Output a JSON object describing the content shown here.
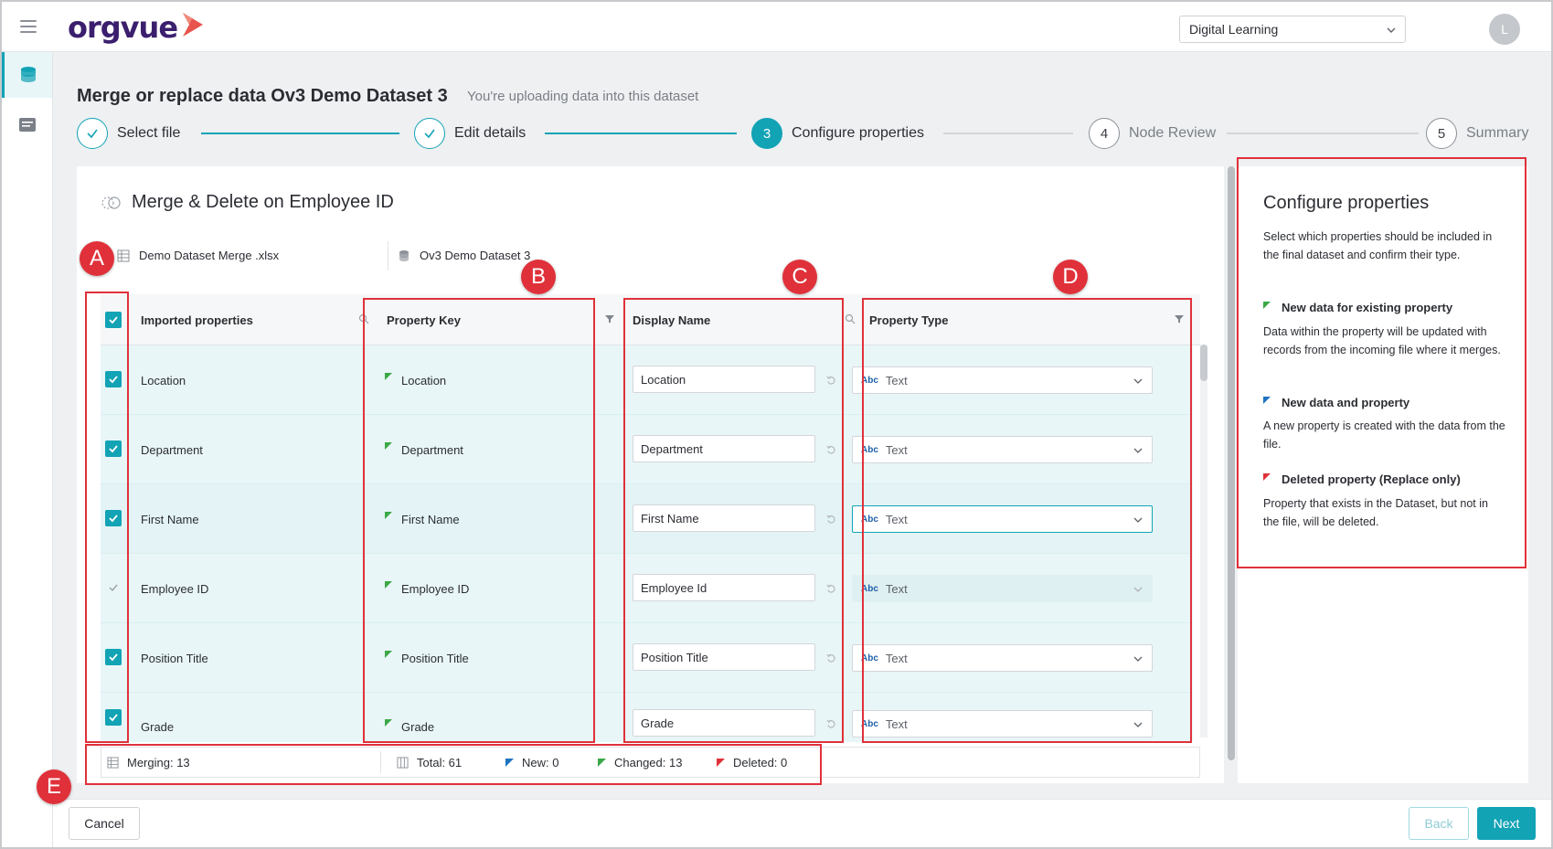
{
  "app": {
    "brand": "orgvue"
  },
  "topbar": {
    "workspace": "Digital Learning",
    "avatar_initial": "L"
  },
  "header": {
    "title": "Merge or replace data Ov3 Demo Dataset 3",
    "subtitle": "You're uploading data into this dataset"
  },
  "steps": [
    {
      "number": "1",
      "label": "Select file",
      "state": "done"
    },
    {
      "number": "2",
      "label": "Edit details",
      "state": "done"
    },
    {
      "number": "3",
      "label": "Configure properties",
      "state": "current"
    },
    {
      "number": "4",
      "label": "Node Review",
      "state": "todo"
    },
    {
      "number": "5",
      "label": "Summary",
      "state": "todo"
    }
  ],
  "merge": {
    "title": "Merge & Delete on Employee ID",
    "source_file": "Demo Dataset Merge .xlsx",
    "target_dataset": "Ov3 Demo Dataset 3"
  },
  "table": {
    "headers": {
      "imported": "Imported properties",
      "key": "Property Key",
      "display": "Display Name",
      "type": "Property Type"
    },
    "rows": [
      {
        "imported": "Location",
        "key": "Location",
        "display": "Location",
        "type_abbr": "Abc",
        "type": "Text",
        "checked": true
      },
      {
        "imported": "Department",
        "key": "Department",
        "display": "Department",
        "type_abbr": "Abc",
        "type": "Text",
        "checked": true
      },
      {
        "imported": "First Name",
        "key": "First Name",
        "display": "First Name",
        "type_abbr": "Abc",
        "type": "Text",
        "checked": true
      },
      {
        "imported": "Employee ID",
        "key": "Employee ID",
        "display": "Employee Id",
        "type_abbr": "Abc",
        "type": "Text",
        "checked": false
      },
      {
        "imported": "Position Title",
        "key": "Position Title",
        "display": "Position Title",
        "type_abbr": "Abc",
        "type": "Text",
        "checked": true
      },
      {
        "imported": "Grade",
        "key": "Grade",
        "display": "Grade",
        "type_abbr": "Abc",
        "type": "Text",
        "checked": true
      }
    ]
  },
  "stats": {
    "merging": "Merging: 13",
    "total": "Total: 61",
    "new": "New: 0",
    "changed": "Changed: 13",
    "deleted": "Deleted: 0"
  },
  "panel": {
    "title": "Configure properties",
    "intro": "Select which properties should be included in the final dataset and confirm their type.",
    "legend": [
      {
        "label": "New data for existing property",
        "desc": "Data within the property will be updated with records from the incoming file where it merges."
      },
      {
        "label": "New data and property",
        "desc": "A new property is created with the data from the file."
      },
      {
        "label": "Deleted property (Replace only)",
        "desc": "Property that exists in the Dataset, but not in the file, will be deleted."
      }
    ]
  },
  "buttons": {
    "cancel": "Cancel",
    "back": "Back",
    "next": "Next"
  },
  "annotations": [
    "A",
    "B",
    "C",
    "D",
    "E"
  ],
  "colors": {
    "accent": "#12a3b5",
    "flag_existing": "#3aa845",
    "flag_new": "#1f74c2",
    "flag_deleted": "#e0313a",
    "annotation": "#e0313a"
  }
}
